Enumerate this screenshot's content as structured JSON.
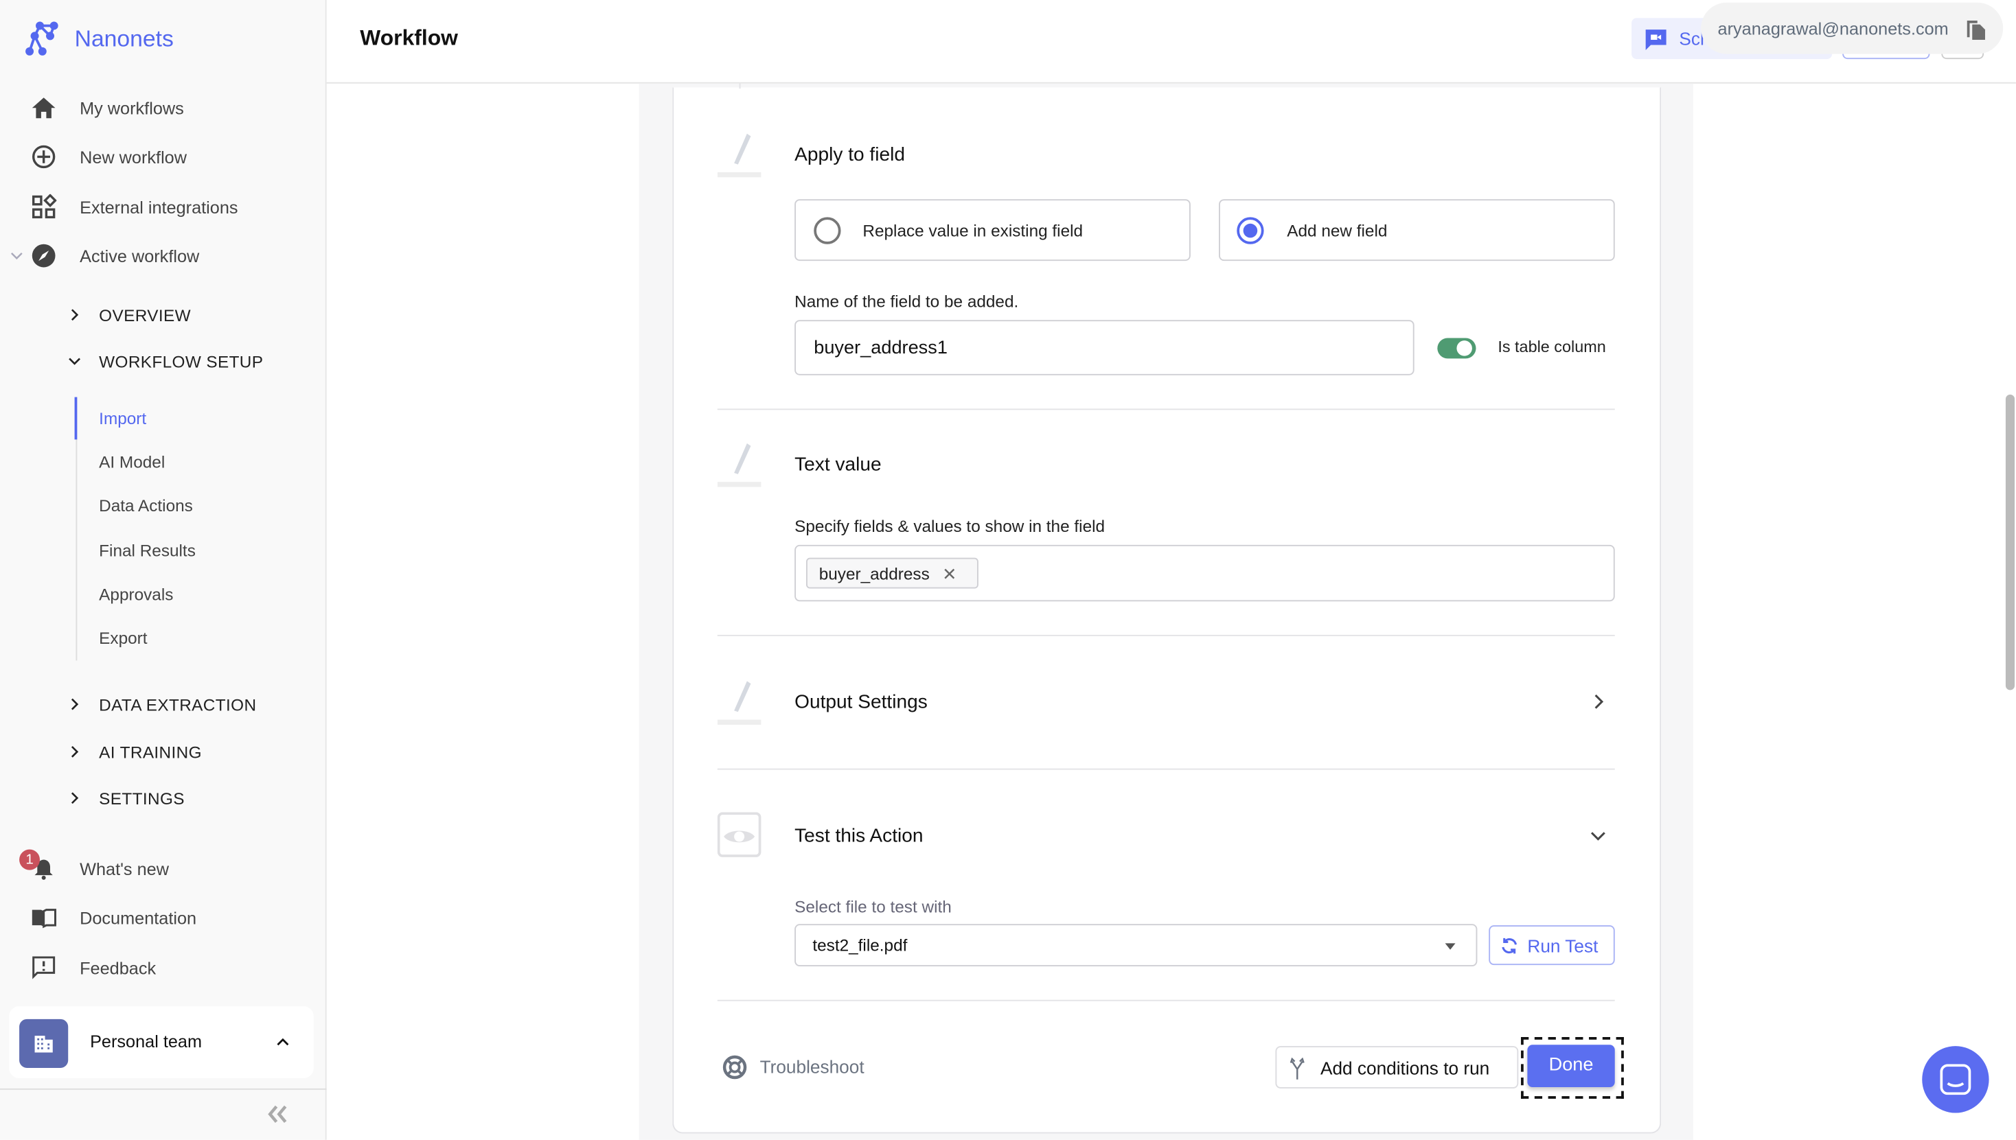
{
  "app": {
    "brand": "Nanonets",
    "page_title": "Workflow",
    "accent": "#5468ef"
  },
  "sidebar": {
    "main_items": [
      {
        "label": "My workflows",
        "icon": "home-icon"
      },
      {
        "label": "New workflow",
        "icon": "plus-circle-icon"
      },
      {
        "label": "External integrations",
        "icon": "widgets-icon"
      },
      {
        "label": "Active workflow",
        "icon": "compass-icon"
      }
    ],
    "sections": [
      {
        "label": "OVERVIEW",
        "expanded": false
      },
      {
        "label": "WORKFLOW SETUP",
        "expanded": true
      },
      {
        "label": "DATA EXTRACTION",
        "expanded": false
      },
      {
        "label": "AI TRAINING",
        "expanded": false
      },
      {
        "label": "SETTINGS",
        "expanded": false
      }
    ],
    "setup_items": [
      {
        "label": "Import",
        "active": true
      },
      {
        "label": "AI Model"
      },
      {
        "label": "Data Actions"
      },
      {
        "label": "Final Results"
      },
      {
        "label": "Approvals"
      },
      {
        "label": "Export"
      }
    ],
    "bottom_items": [
      {
        "label": "What's new",
        "icon": "bell-icon",
        "badge": "1"
      },
      {
        "label": "Documentation",
        "icon": "book-icon"
      },
      {
        "label": "Feedback",
        "icon": "feedback-icon"
      }
    ],
    "team": {
      "label": "Personal team"
    }
  },
  "header": {
    "schedule_label": "Sch",
    "tooltip_email": "aryanagrawal@nanonets.com"
  },
  "form": {
    "apply": {
      "title": "Apply to field",
      "option_replace": "Replace value in existing field",
      "option_add": "Add new field",
      "selected": "add"
    },
    "field_name": {
      "label": "Name of the field to be added.",
      "value": "buyer_address1",
      "table_toggle_label": "Is table column",
      "table_toggle_on": true
    },
    "text_value": {
      "title": "Text value",
      "label": "Specify fields & values to show in the field",
      "tags": [
        "buyer_address"
      ]
    },
    "output": {
      "title": "Output Settings"
    },
    "test": {
      "title": "Test this Action",
      "file_label": "Select file to test with",
      "file_value": "test2_file.pdf",
      "run_label": "Run Test"
    },
    "footer": {
      "troubleshoot": "Troubleshoot",
      "conditions": "Add conditions to run",
      "done": "Done"
    }
  }
}
